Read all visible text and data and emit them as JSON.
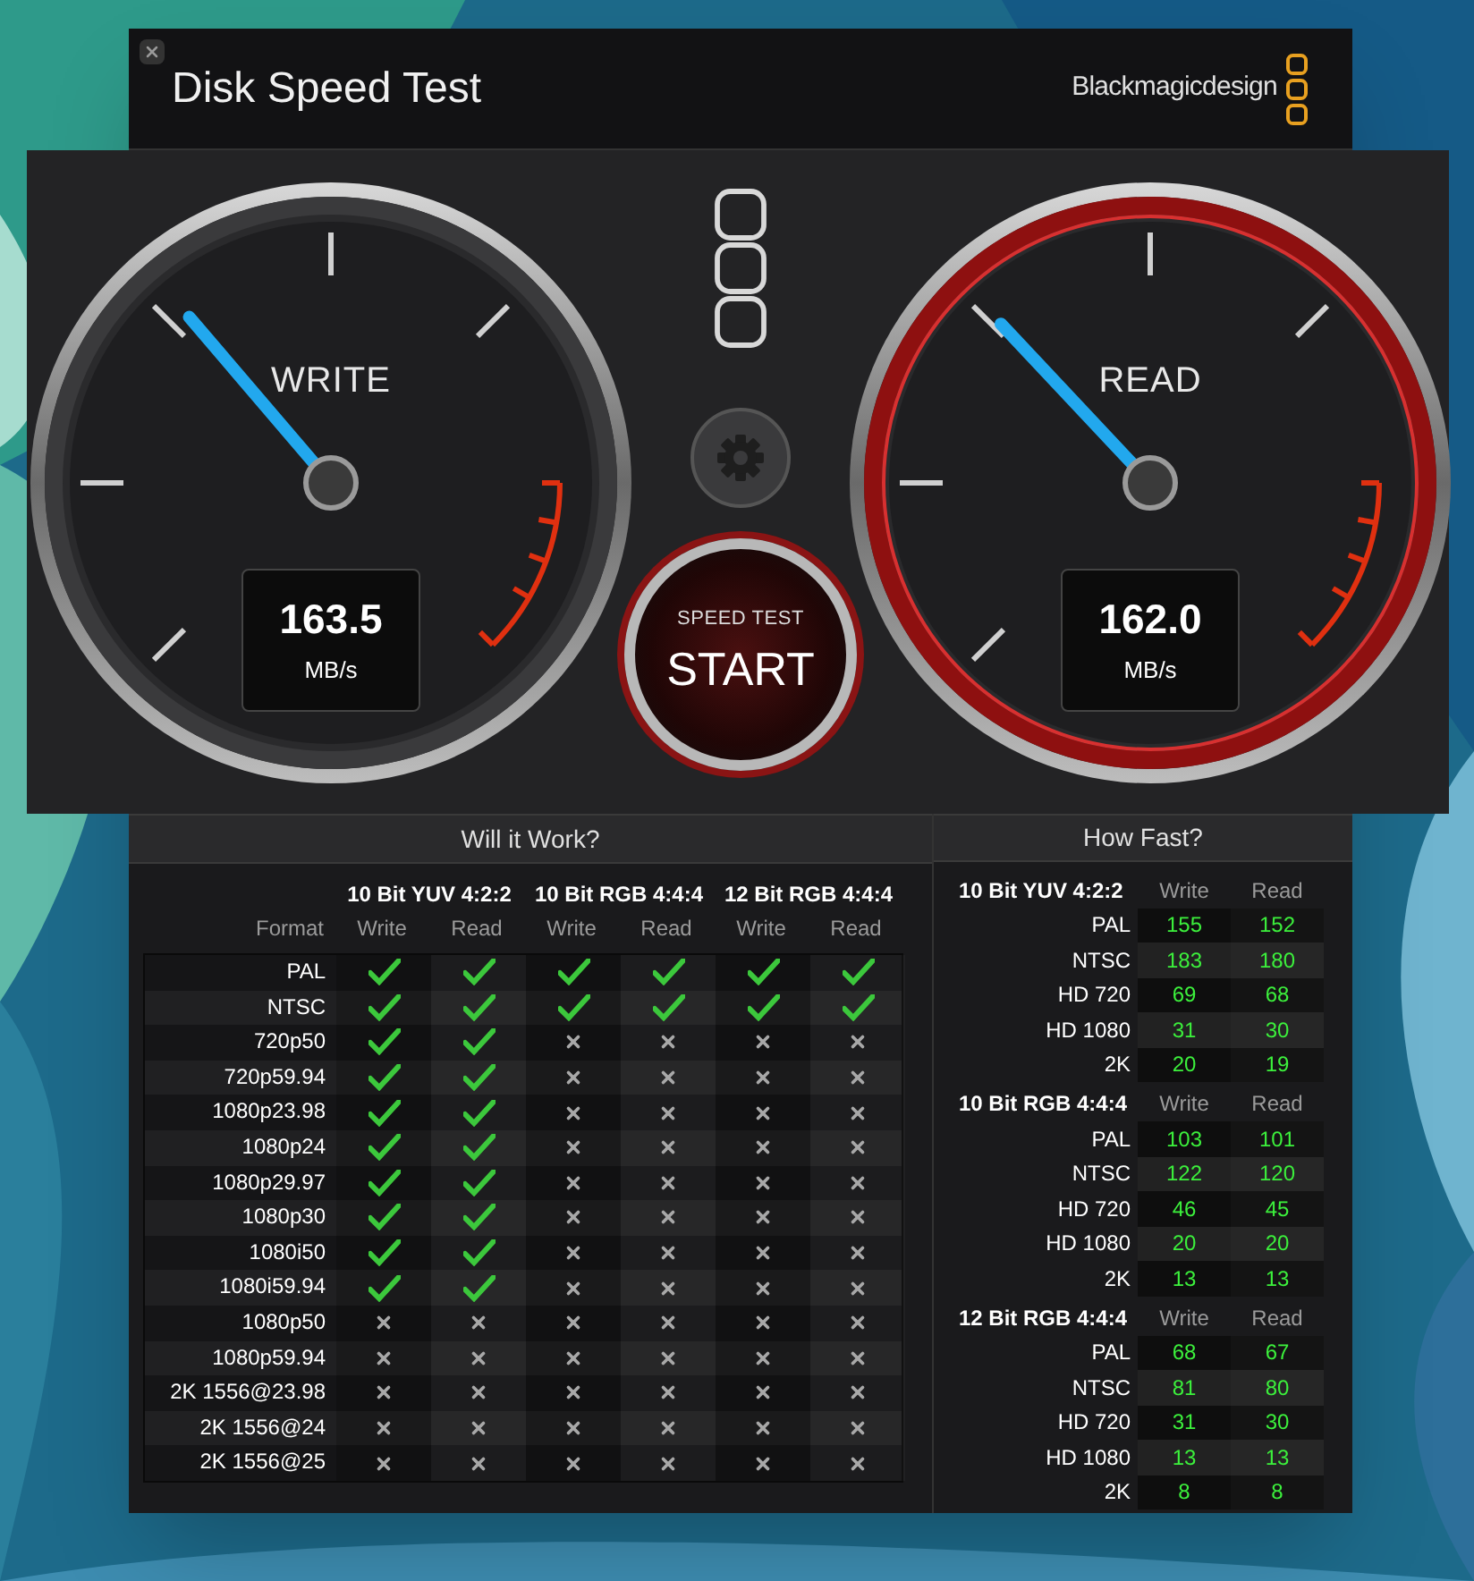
{
  "window": {
    "title": "Disk Speed Test",
    "brand": "Blackmagicdesign"
  },
  "gauges": [
    {
      "label": "WRITE",
      "value": "163.5",
      "unit": "MB/s",
      "level": 0.35,
      "active": false
    },
    {
      "label": "READ",
      "value": "162.0",
      "unit": "MB/s",
      "level": 0.34,
      "active": true
    }
  ],
  "start_button": {
    "caption": "SPEED TEST",
    "label": "START"
  },
  "will_it_work": {
    "title": "Will it Work?",
    "groups": [
      "10 Bit YUV 4:2:2",
      "10 Bit RGB 4:4:4",
      "12 Bit RGB 4:4:4"
    ],
    "columns": [
      "Format",
      "Write",
      "Read",
      "Write",
      "Read",
      "Write",
      "Read"
    ],
    "rows": [
      {
        "format": "PAL",
        "results": [
          true,
          true,
          true,
          true,
          true,
          true
        ]
      },
      {
        "format": "NTSC",
        "results": [
          true,
          true,
          true,
          true,
          true,
          true
        ]
      },
      {
        "format": "720p50",
        "results": [
          true,
          true,
          false,
          false,
          false,
          false
        ]
      },
      {
        "format": "720p59.94",
        "results": [
          true,
          true,
          false,
          false,
          false,
          false
        ]
      },
      {
        "format": "1080p23.98",
        "results": [
          true,
          true,
          false,
          false,
          false,
          false
        ]
      },
      {
        "format": "1080p24",
        "results": [
          true,
          true,
          false,
          false,
          false,
          false
        ]
      },
      {
        "format": "1080p29.97",
        "results": [
          true,
          true,
          false,
          false,
          false,
          false
        ]
      },
      {
        "format": "1080p30",
        "results": [
          true,
          true,
          false,
          false,
          false,
          false
        ]
      },
      {
        "format": "1080i50",
        "results": [
          true,
          true,
          false,
          false,
          false,
          false
        ]
      },
      {
        "format": "1080i59.94",
        "results": [
          true,
          true,
          false,
          false,
          false,
          false
        ]
      },
      {
        "format": "1080p50",
        "results": [
          false,
          false,
          false,
          false,
          false,
          false
        ]
      },
      {
        "format": "1080p59.94",
        "results": [
          false,
          false,
          false,
          false,
          false,
          false
        ]
      },
      {
        "format": "2K 1556@23.98",
        "results": [
          false,
          false,
          false,
          false,
          false,
          false
        ]
      },
      {
        "format": "2K 1556@24",
        "results": [
          false,
          false,
          false,
          false,
          false,
          false
        ]
      },
      {
        "format": "2K 1556@25",
        "results": [
          false,
          false,
          false,
          false,
          false,
          false
        ]
      }
    ]
  },
  "how_fast": {
    "title": "How Fast?",
    "groups": [
      {
        "title": "10 Bit YUV 4:2:2",
        "write_label": "Write",
        "read_label": "Read",
        "rows": [
          {
            "format": "PAL",
            "write": "155",
            "read": "152"
          },
          {
            "format": "NTSC",
            "write": "183",
            "read": "180"
          },
          {
            "format": "HD 720",
            "write": "69",
            "read": "68"
          },
          {
            "format": "HD 1080",
            "write": "31",
            "read": "30"
          },
          {
            "format": "2K",
            "write": "20",
            "read": "19"
          }
        ]
      },
      {
        "title": "10 Bit RGB 4:4:4",
        "write_label": "Write",
        "read_label": "Read",
        "rows": [
          {
            "format": "PAL",
            "write": "103",
            "read": "101"
          },
          {
            "format": "NTSC",
            "write": "122",
            "read": "120"
          },
          {
            "format": "HD 720",
            "write": "46",
            "read": "45"
          },
          {
            "format": "HD 1080",
            "write": "20",
            "read": "20"
          },
          {
            "format": "2K",
            "write": "13",
            "read": "13"
          }
        ]
      },
      {
        "title": "12 Bit RGB 4:4:4",
        "write_label": "Write",
        "read_label": "Read",
        "rows": [
          {
            "format": "PAL",
            "write": "68",
            "read": "67"
          },
          {
            "format": "NTSC",
            "write": "81",
            "read": "80"
          },
          {
            "format": "HD 720",
            "write": "31",
            "read": "30"
          },
          {
            "format": "HD 1080",
            "write": "13",
            "read": "13"
          },
          {
            "format": "2K",
            "write": "8",
            "read": "8"
          }
        ]
      }
    ]
  }
}
